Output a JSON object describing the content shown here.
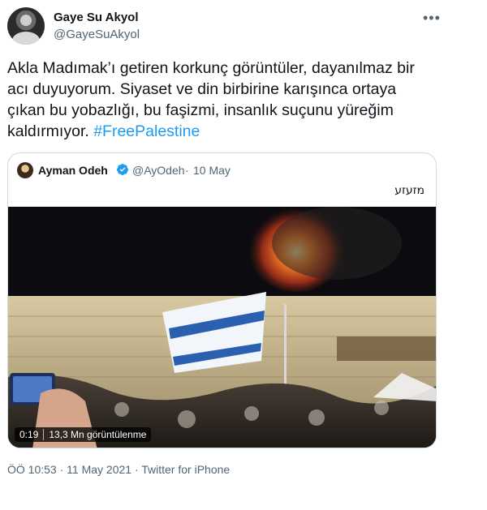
{
  "author": {
    "name": "Gaye Su Akyol",
    "handle": "@GayeSuAkyol",
    "more_icon": "more-horizontal-icon"
  },
  "tweet": {
    "text": "Akla Madımak’ı getiren korkunç görüntüler, dayanılmaz bir acı duyuyorum. Siyaset ve din birbirine karışınca ortaya çıkan bu yobazlığı, bu faşizmi, insanlık suçunu yüreğim kaldırmıyor.",
    "hashtag": "#FreePalestine",
    "hashtag_color": "#1d9bf0"
  },
  "quoted": {
    "name": "Ayman Odeh",
    "verified_icon": "verified-badge-icon",
    "verified_color": "#1d9bf0",
    "handle": "@AyOdeh",
    "separator": "·",
    "date": "10 May",
    "text": "מזעזע",
    "video": {
      "time": "0:19",
      "views": "13,3 Mn görüntülenme"
    }
  },
  "footer": {
    "text": "ÖÖ 10:53 · 11 May 2021 · Twitter for iPhone"
  }
}
